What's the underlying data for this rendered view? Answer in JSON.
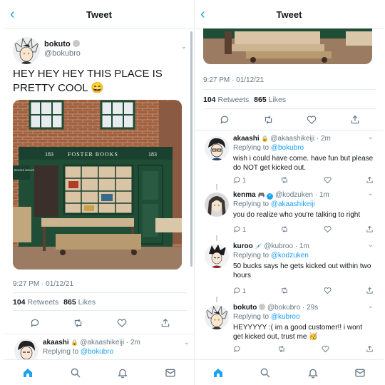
{
  "header": {
    "title": "Tweet",
    "back_icon": "chevron-left-icon"
  },
  "tweet": {
    "author_name": "bokuto",
    "author_handle": "@bokubro",
    "text": "HEY HEY HEY THIS PLACE IS PRETTY COOL 😄",
    "photo_sign": "FOSTER BOOKS",
    "photo_sign_numbers": [
      "183",
      "183"
    ],
    "photo_side_sign": "BOOKS BOUGHT & SOLD",
    "timestamp": "9:27 PM · 01/12/21",
    "retweet_count": "104",
    "retweet_label": "Retweets",
    "like_count": "865",
    "like_label": "Likes"
  },
  "left_partial_reply": {
    "name": "akaashi",
    "handle": "@akaashikeiji",
    "time": "· 2m",
    "replying": "Replying to",
    "replying_to": "@bokubro"
  },
  "replies": [
    {
      "name": "akaashi",
      "handle": "@akaashikeiji",
      "time": "· 2m",
      "replying": "Replying to",
      "replying_to": "@bokubro",
      "text": "wish i could have come. have fun but please do NOT get kicked out.",
      "reply_count": "1",
      "avatar": "akaashi-avatar"
    },
    {
      "name": "kenma",
      "handle": "@kodzuken",
      "time": "· 1m",
      "replying": "Replying to",
      "replying_to": "@akaashikeiji",
      "text": "you do realize who you're talking to right",
      "reply_count": "1",
      "avatar": "kenma-avatar"
    },
    {
      "name": "kuroo",
      "handle": "@kubroo",
      "time": "· 1m",
      "replying": "Replying to",
      "replying_to": "@kodzuken",
      "text": "50 bucks says he gets kicked out within two hours",
      "reply_count": "1",
      "avatar": "kuroo-avatar"
    },
    {
      "name": "bokuto",
      "handle": "@bokubro",
      "time": "· 29s",
      "replying": "Replying to",
      "replying_to": "@kubroo",
      "text": "HEYYYYY :( im a good customer!! i wont get kicked out, trust me 🥳",
      "reply_count": "",
      "avatar": "bokuto-avatar"
    }
  ],
  "tabs": [
    "home-icon",
    "search-icon",
    "notifications-icon",
    "messages-icon"
  ],
  "colors": {
    "accent": "#1da1f2",
    "muted": "#657786",
    "border": "#e6ecf0",
    "shopfront": "#1f4d36",
    "brick": "#9a5a3a"
  }
}
